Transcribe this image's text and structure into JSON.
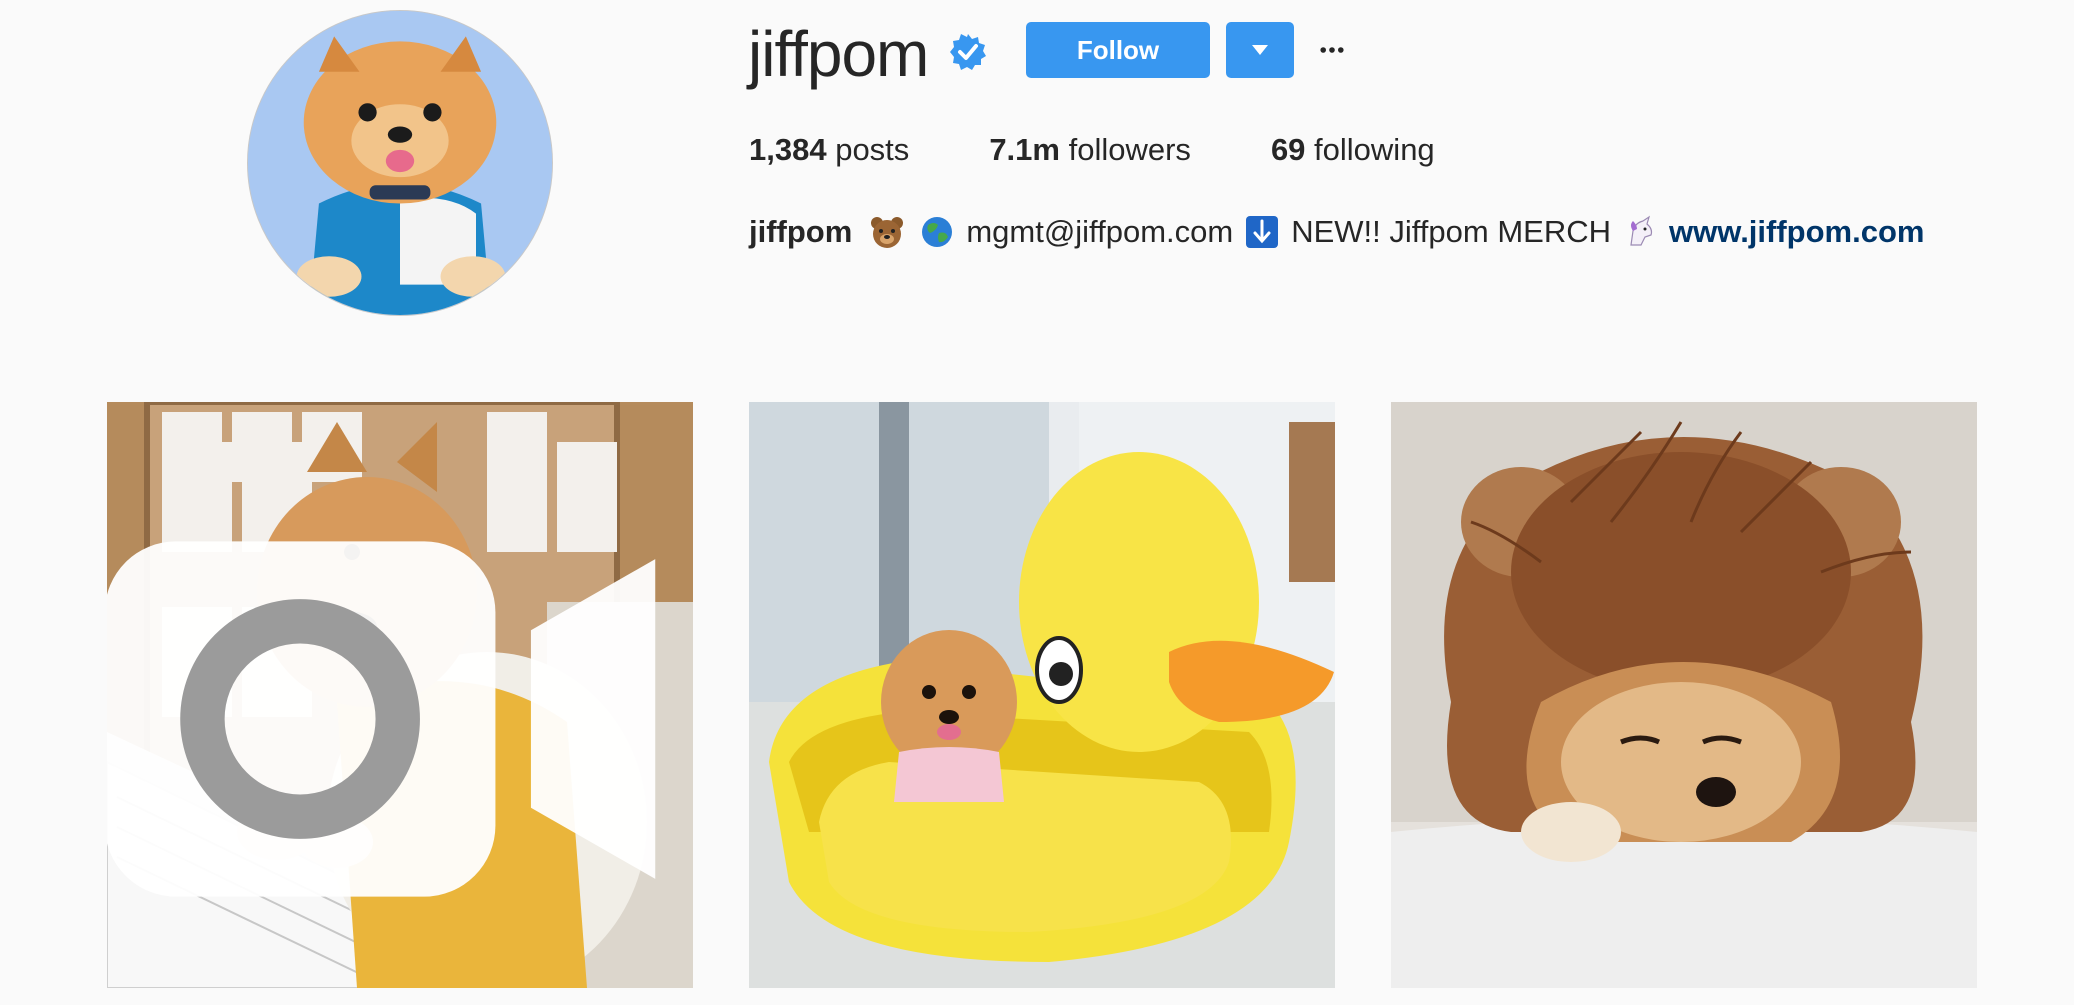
{
  "profile": {
    "username": "jiffpom",
    "verified": true,
    "avatar_alt": "profile picture",
    "buttons": {
      "follow_label": "Follow",
      "dropdown_icon": "caret-down-icon",
      "more_icon": "more-options-icon"
    },
    "stats": {
      "posts_count": "1,384",
      "posts_label": "posts",
      "followers_count": "7.1m",
      "followers_label": "followers",
      "following_count": "69",
      "following_label": "following"
    },
    "bio": {
      "name": "jiffpom",
      "email": "mgmt@jiffpom.com",
      "merch_text": "NEW!! Jiffpom MERCH",
      "link": "www.jiffpom.com"
    }
  },
  "posts": [
    {
      "type": "video",
      "icon": "video-icon"
    },
    {
      "type": "photo"
    },
    {
      "type": "photo"
    }
  ],
  "colors": {
    "accent": "#3897f0",
    "background": "#fafafa",
    "text": "#262626",
    "link": "#003569",
    "verified": "#3897f0"
  }
}
